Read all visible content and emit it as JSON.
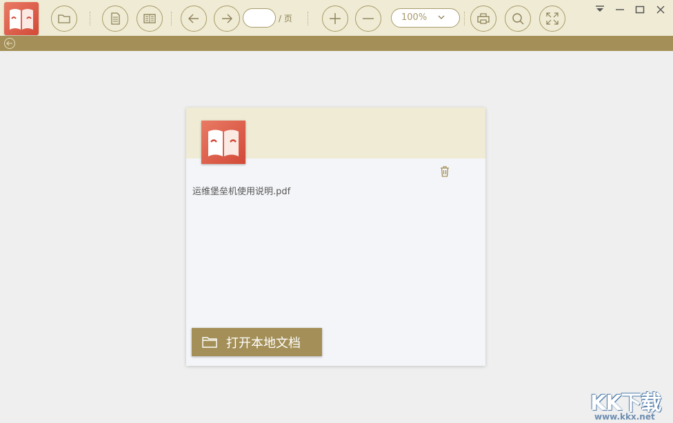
{
  "toolbar": {
    "page_suffix": "/ 页",
    "page_value": "",
    "zoom_value": "100%",
    "buttons": [
      "open-folder",
      "single-page",
      "double-page",
      "previous-page",
      "next-page",
      "zoom-in",
      "zoom-out",
      "print",
      "search",
      "fullscreen"
    ]
  },
  "window": {
    "controls": [
      "dropdown",
      "minimize",
      "maximize",
      "close"
    ]
  },
  "card": {
    "file_name": "运维堡垒机使用说明.pdf",
    "open_button_label": "打开本地文档"
  },
  "watermark": {
    "text": "KK下载",
    "url": "www.kkx.net"
  },
  "colors": {
    "toolbar_bg": "#efebd4",
    "accent": "#a38f57",
    "logo_red": "#d24a38",
    "background": "#efefef"
  }
}
